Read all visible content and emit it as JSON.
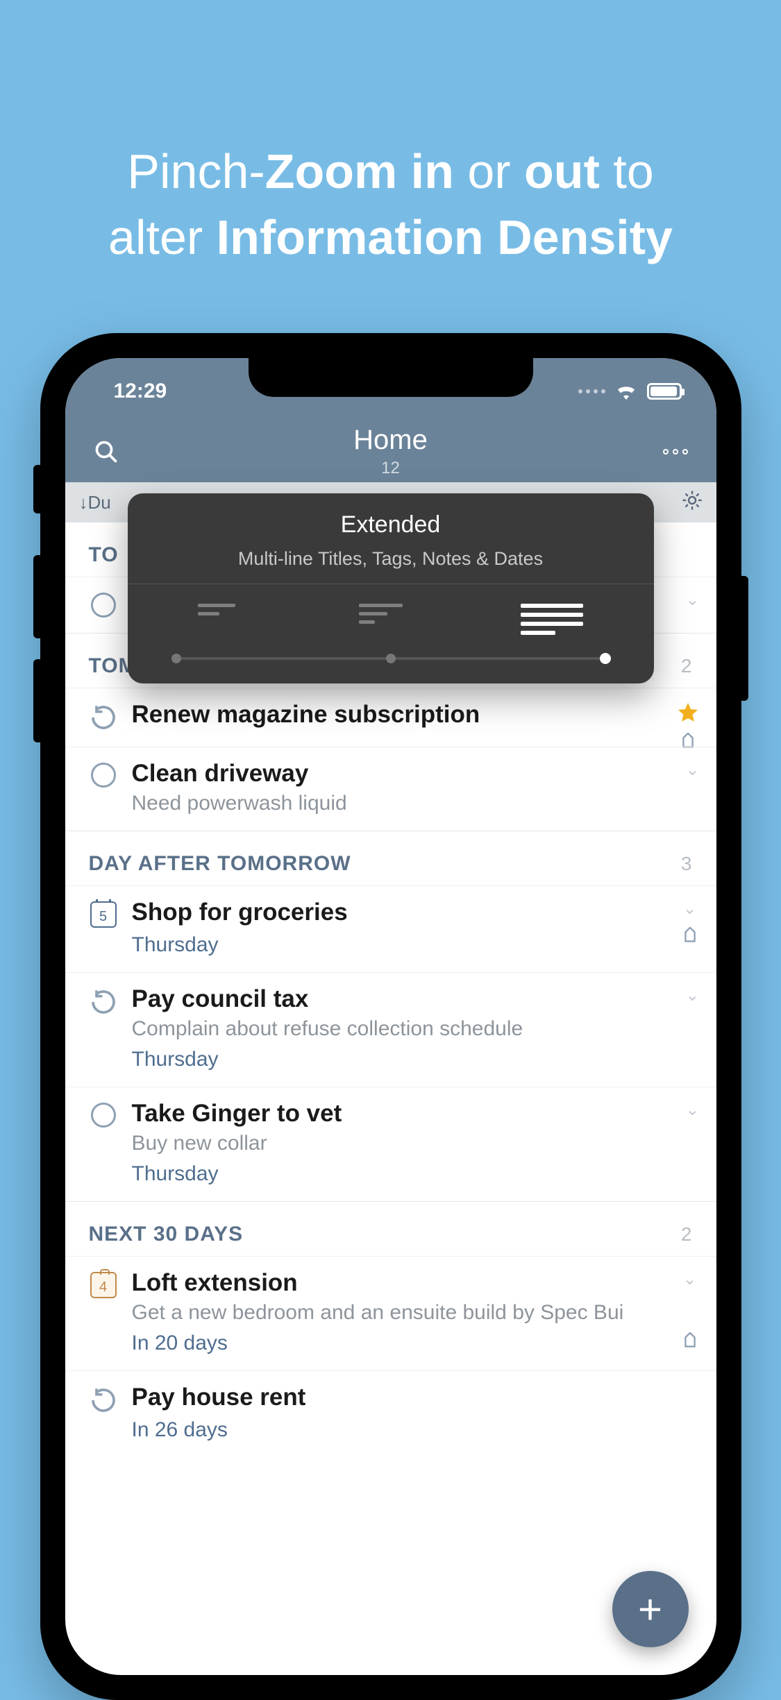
{
  "promo": {
    "line1a": "Pinch-",
    "line1b": "Zoom in",
    "line1c": " or ",
    "line1d": "out",
    "line1e": " to",
    "line2a": "alter ",
    "line2b": "Information Density"
  },
  "status": {
    "time": "12:29"
  },
  "nav": {
    "title": "Home",
    "subtitle": "12"
  },
  "filter": {
    "left": "↓Du",
    "right_icon": "brightness"
  },
  "popup": {
    "title": "Extended",
    "subtitle": "Multi-line Titles, Tags, Notes & Dates"
  },
  "sections": {
    "today": {
      "label": "TO",
      "count": ""
    },
    "tomorrow": {
      "label": "TOMORROW",
      "count": "2"
    },
    "day_after": {
      "label": "DAY AFTER TOMORROW",
      "count": "3"
    },
    "next30": {
      "label": "NEXT 30 DAYS",
      "count": "2"
    }
  },
  "tasks": {
    "t1": {
      "title": "Renew magazine subscription"
    },
    "t2": {
      "title": "Clean driveway",
      "note": "Need powerwash liquid"
    },
    "t3": {
      "title": "Shop for groceries",
      "date": "Thursday",
      "cal": "5"
    },
    "t4": {
      "title": "Pay council tax",
      "note": "Complain about refuse collection schedule",
      "date": "Thursday"
    },
    "t5": {
      "title": "Take Ginger to vet",
      "note": "Buy new collar",
      "date": "Thursday"
    },
    "t6": {
      "title": "Loft extension",
      "note": "Get a new bedroom and an ensuite build by Spec Bui",
      "date": "In 20 days",
      "brief": "4"
    },
    "t7": {
      "title": "Pay house rent",
      "date": "In 26 days"
    }
  }
}
